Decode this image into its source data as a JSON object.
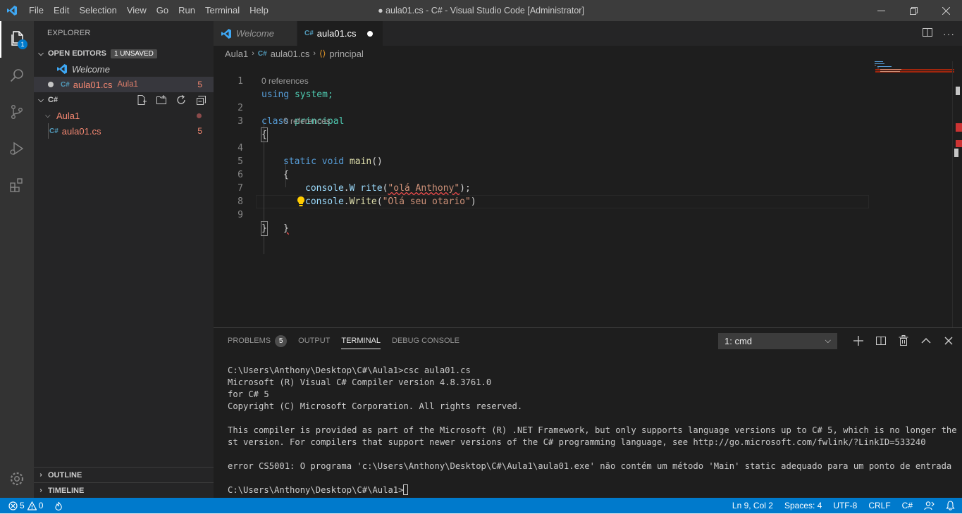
{
  "window": {
    "title": "● aula01.cs - C# - Visual Studio Code [Administrator]",
    "menu": [
      "File",
      "Edit",
      "Selection",
      "View",
      "Go",
      "Run",
      "Terminal",
      "Help"
    ],
    "controls": [
      "minimize-icon",
      "restore-icon",
      "close-icon"
    ]
  },
  "activity_bar": {
    "items": [
      "files-icon",
      "search-icon",
      "source-control-icon",
      "run-debug-icon",
      "extensions-icon"
    ],
    "explorer_badge": "1",
    "bottom": "gear-icon"
  },
  "sidebar": {
    "title": "EXPLORER",
    "open_editors": {
      "label": "OPEN EDITORS",
      "badge": "1 UNSAVED",
      "items": [
        {
          "name": "Welcome"
        },
        {
          "name": "aula01.cs",
          "folder": "Aula1",
          "count": "5"
        }
      ]
    },
    "workspace": {
      "label": "C#",
      "folder": "Aula1",
      "file": "aula01.cs",
      "file_count": "5"
    },
    "outline": "OUTLINE",
    "timeline": "TIMELINE"
  },
  "tabs": [
    {
      "label": "Welcome"
    },
    {
      "label": "aula01.cs"
    }
  ],
  "breadcrumb": {
    "folder": "Aula1",
    "file": "aula01.cs",
    "symbol": "principal"
  },
  "editor": {
    "line_numbers": [
      "1",
      "2",
      "3",
      "4",
      "5",
      "6",
      "7",
      "8",
      "9"
    ],
    "codelens": "0 references",
    "code": {
      "l1_kw": "using",
      "l1_ns": " system;",
      "l2_kw": "class",
      "l2_name": " principal",
      "l3": "{",
      "l4_kw": "static void",
      "l4_fn": " main",
      "l4_rest": "()",
      "l5": "{",
      "l6_obj": "console",
      "l6_dot": ".",
      "l6_fn": "W rite",
      "l6_open": "(",
      "l6_str": "\"olá Anthony\"",
      "l6_close": ");",
      "l7_obj": "console",
      "l7_dot": ".",
      "l7_fn": "Write",
      "l7_open": "(",
      "l7_str": "\"Olá seu otario\"",
      "l7_close": ")",
      "l8": "}",
      "l9": "}"
    }
  },
  "panel": {
    "tabs": [
      "PROBLEMS",
      "OUTPUT",
      "TERMINAL",
      "DEBUG CONSOLE"
    ],
    "problems_count": "5",
    "terminal_select": "1: cmd",
    "terminal_lines": [
      "C:\\Users\\Anthony\\Desktop\\C#\\Aula1>csc aula01.cs",
      "Microsoft (R) Visual C# Compiler version 4.8.3761.0",
      "for C# 5",
      "Copyright (C) Microsoft Corporation. All rights reserved.",
      "",
      "This compiler is provided as part of the Microsoft (R) .NET Framework, but only supports language versions up to C# 5, which is no longer the late",
      "st version. For compilers that support newer versions of the C# programming language, see http://go.microsoft.com/fwlink/?LinkID=533240",
      "",
      "error CS5001: O programa 'c:\\Users\\Anthony\\Desktop\\C#\\Aula1\\aula01.exe' não contém um método 'Main' static adequado para um ponto de entrada",
      ""
    ],
    "prompt": "C:\\Users\\Anthony\\Desktop\\C#\\Aula1>"
  },
  "status": {
    "errors": "5",
    "warnings": "0",
    "position": "Ln 9, Col 2",
    "spaces": "Spaces: 4",
    "encoding": "UTF-8",
    "eol": "CRLF",
    "language": "C#"
  },
  "colors": {
    "accent": "#007acc",
    "error": "#f48771",
    "background": "#1e1e1e"
  }
}
